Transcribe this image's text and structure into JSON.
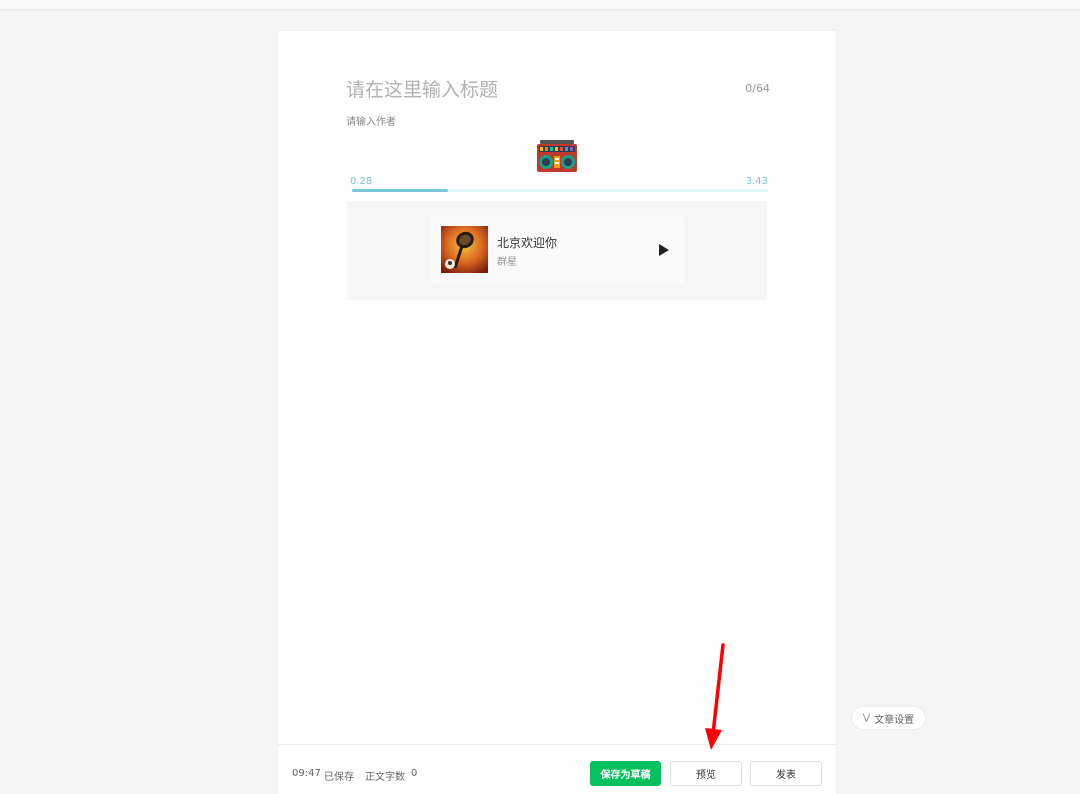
{
  "editor": {
    "title_placeholder": "请在这里输入标题",
    "title_counter": "0/64",
    "author_placeholder": "请输入作者"
  },
  "audio": {
    "current_time": "0.28",
    "total_time": "3.43",
    "progress_fraction": 0.23
  },
  "music": {
    "song_title": "北京欢迎你",
    "artist": "群星"
  },
  "footer": {
    "time": "09:47",
    "saved_label": "已保存",
    "wordcount_label": "正文字数",
    "wordcount_value": "0",
    "draft_button": "保存为草稿",
    "preview_button": "预览",
    "publish_button": "发表"
  },
  "settings": {
    "label": "文章设置"
  },
  "colors": {
    "accent_green": "#07c160",
    "audio_blue": "#79c7d8",
    "annotation_red": "#ff0000"
  }
}
